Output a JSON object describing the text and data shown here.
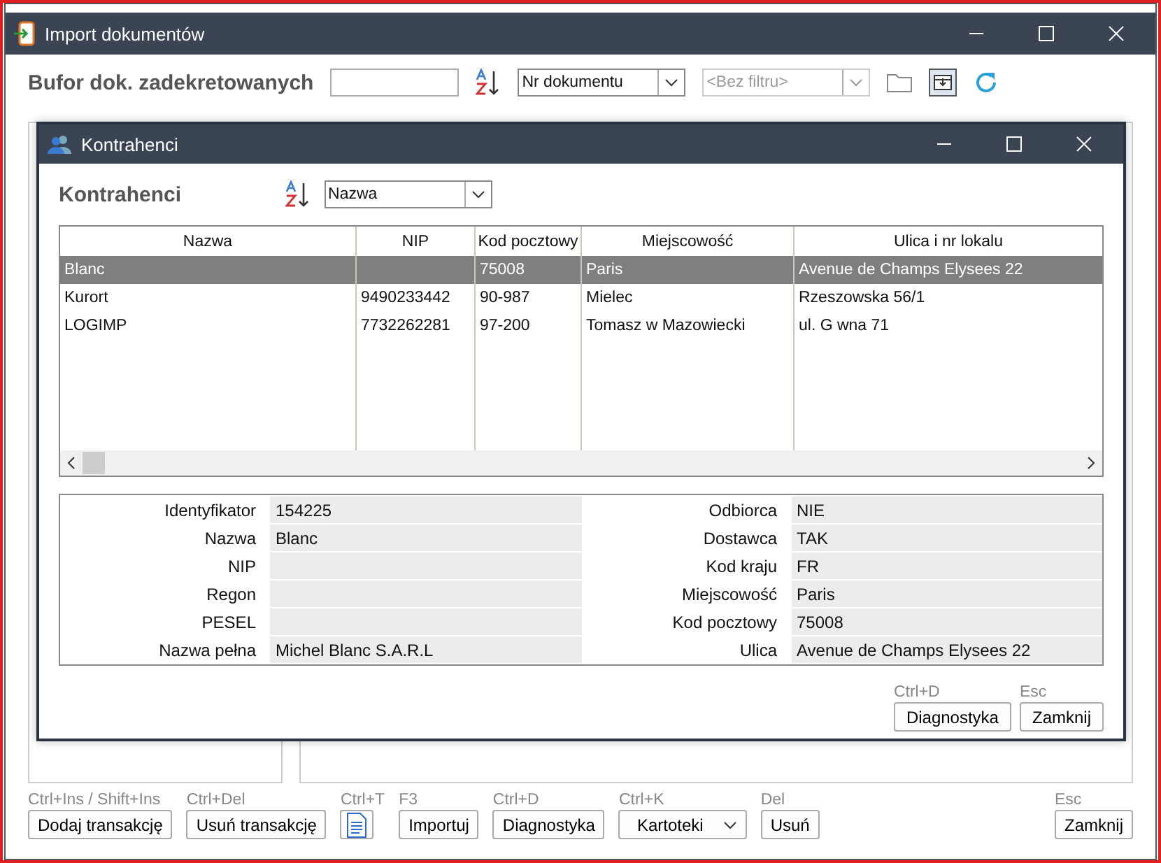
{
  "window": {
    "title": "Import dokumentów"
  },
  "toolbar": {
    "title": "Bufor dok. zadekretowanych",
    "sort_field": "Nr dokumentu",
    "filter": {
      "value": "<Bez filtru>",
      "disabled": true
    }
  },
  "dialog": {
    "title": "Kontrahenci",
    "heading": "Kontrahenci",
    "sort_field": "Nazwa",
    "table": {
      "columns": [
        "Nazwa",
        "NIP",
        "Kod pocztowy",
        "Miejscowość",
        "Ulica i nr lokalu"
      ],
      "rows": [
        {
          "cells": [
            "Blanc",
            "",
            "75008",
            "Paris",
            "Avenue de Champs Elysees 22"
          ],
          "selected": true
        },
        {
          "cells": [
            "Kurort",
            "9490233442",
            "90-987",
            "Mielec",
            "Rzeszowska 56/1"
          ],
          "selected": false
        },
        {
          "cells": [
            "LOGIMP",
            "7732262281",
            "97-200",
            "Tomasz w Mazowiecki",
            "ul. G  wna 71"
          ],
          "selected": false
        }
      ]
    },
    "details_left": [
      {
        "label": "Identyfikator",
        "value": "154225"
      },
      {
        "label": "Nazwa",
        "value": "Blanc"
      },
      {
        "label": "NIP"
      },
      {
        "label": "Regon"
      },
      {
        "label": "PESEL"
      },
      {
        "label": "Nazwa pełna",
        "value": "Michel Blanc S.A.R.L"
      }
    ],
    "details_right": [
      {
        "label": "Odbiorca",
        "value": "NIE"
      },
      {
        "label": "Dostawca",
        "value": "TAK"
      },
      {
        "label": "Kod kraju",
        "value": "FR"
      },
      {
        "label": "Miejscowość",
        "value": "Paris"
      },
      {
        "label": "Kod pocztowy",
        "value": "75008"
      },
      {
        "label": "Ulica",
        "value": "Avenue de Champs Elysees 22"
      }
    ],
    "buttons": [
      {
        "shortcut": "Ctrl+D",
        "label": "Diagnostyka"
      },
      {
        "shortcut": "Esc",
        "label": "Zamknij"
      }
    ]
  },
  "bottom_buttons": [
    {
      "kind": "button",
      "shortcut": "Ctrl+Ins / Shift+Ins",
      "label": "Dodaj transakcję"
    },
    {
      "kind": "button",
      "shortcut": "Ctrl+Del",
      "label": "Usuń transakcję"
    },
    {
      "kind": "icon",
      "shortcut": "Ctrl+T"
    },
    {
      "kind": "button",
      "shortcut": "F3",
      "label": "Importuj"
    },
    {
      "kind": "button",
      "shortcut": "Ctrl+D",
      "label": "Diagnostyka"
    },
    {
      "kind": "dropdown",
      "shortcut": "Ctrl+K",
      "label": "Kartoteki"
    },
    {
      "kind": "button",
      "shortcut": "Del",
      "label": "Usuń"
    },
    {
      "kind": "spacer"
    },
    {
      "kind": "button",
      "shortcut": "Esc",
      "label": "Zamknij"
    }
  ]
}
